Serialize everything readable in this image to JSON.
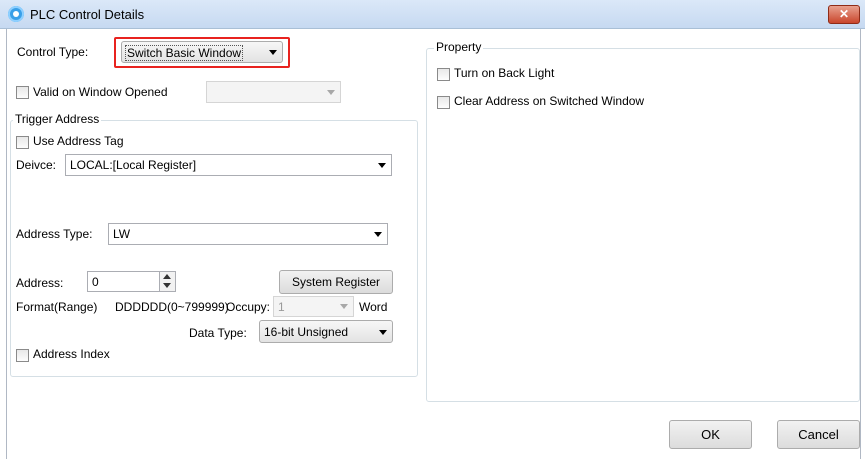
{
  "window": {
    "title": "PLC Control Details",
    "close_glyph": "✕"
  },
  "control_type": {
    "label": "Control Type:",
    "value": "Switch Basic Window",
    "highlight_color": "#e8231f"
  },
  "valid_on_window_opened": {
    "label": "Valid on Window Opened",
    "checked": false,
    "combo_value": ""
  },
  "trigger_address": {
    "title": "Trigger Address",
    "use_address_tag_label": "Use Address Tag",
    "device_label": "Deivce:",
    "device_value": "LOCAL:[Local Register]",
    "address_type_label": "Address Type:",
    "address_type_value": "LW",
    "address_label": "Address:",
    "address_value": "0",
    "system_register_label": "System Register",
    "format_label": "Format(Range)",
    "format_value": "DDDDDD(0~799999)",
    "occupy_label": "Occupy:",
    "occupy_value": "1",
    "word_label": "Word",
    "data_type_label": "Data Type:",
    "data_type_value": "16-bit Unsigned",
    "address_index_label": "Address Index"
  },
  "property": {
    "title": "Property",
    "turn_on_back_light_label": "Turn on Back Light",
    "clear_address_label": "Clear Address on Switched Window"
  },
  "footer": {
    "ok_label": "OK",
    "cancel_label": "Cancel"
  }
}
